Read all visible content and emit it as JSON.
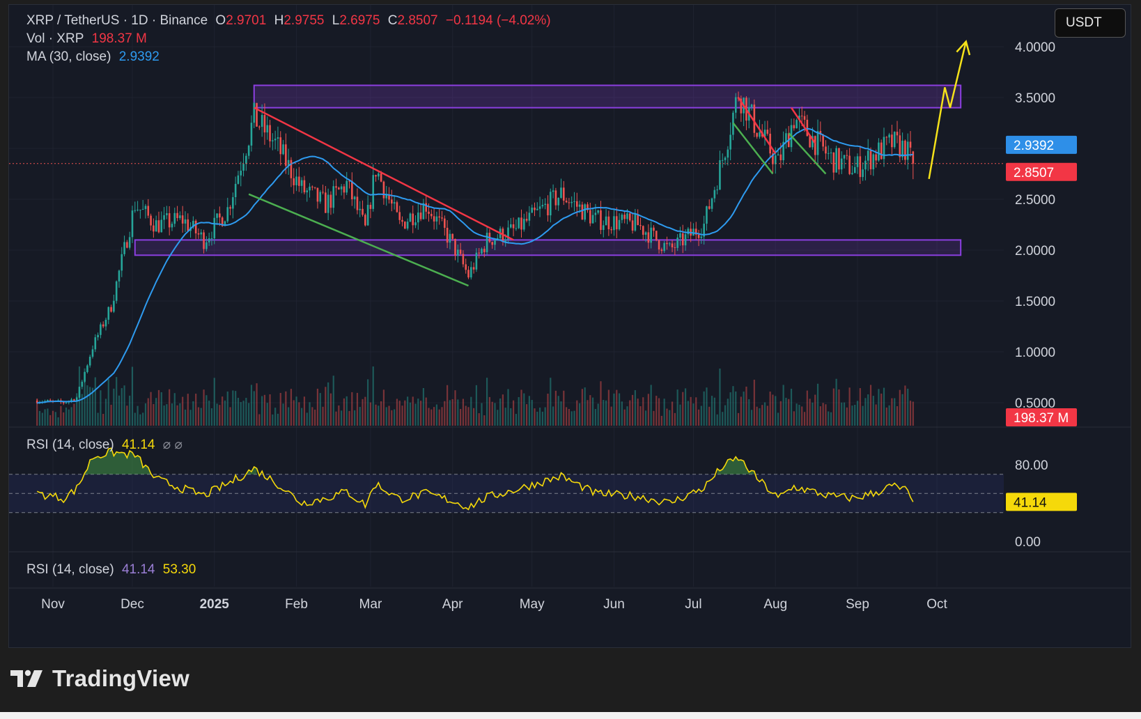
{
  "header": {
    "symbol": "XRP / TetherUS · 1D · Binance",
    "o_label": "O",
    "o_value": "2.9701",
    "h_label": "H",
    "h_value": "2.9755",
    "l_label": "L",
    "l_value": "2.6975",
    "c_label": "C",
    "c_value": "2.8507",
    "change": "−0.1194 (−4.02%)",
    "vol_label": "Vol · XRP",
    "vol_value": "198.37 M",
    "ma_label": "MA (30, close)",
    "ma_value": "2.9392"
  },
  "currency_button": "USDT",
  "rsi_legend": {
    "label": "RSI (14, close)",
    "value": "41.14",
    "icons": "⌀ ⌀"
  },
  "rsi_legend2": {
    "label": "RSI (14, close)",
    "value1": "41.14",
    "value2": "53.30"
  },
  "brand": {
    "name": "TradingView"
  },
  "colors": {
    "background": "#161a25",
    "up": "#26a69a",
    "down": "#ef5350",
    "ma": "#2e9bf0",
    "rsi": "#f5d90a",
    "zone": "#8c3fe0",
    "downtrend": "#f23645",
    "support": "#4caf50",
    "arrow": "#f5e21a"
  },
  "chart_data": [
    {
      "type": "candlestick",
      "title": "XRP / TetherUS · 1D · Binance",
      "x_ticks": [
        "Nov",
        "Dec",
        "2025",
        "Feb",
        "Mar",
        "Apr",
        "May",
        "Jun",
        "Jul",
        "Aug",
        "Sep",
        "Oct"
      ],
      "y_ticks": [
        "0.5000",
        "1.0000",
        "1.5000",
        "2.0000",
        "2.5000",
        "3.5000",
        "4.0000"
      ],
      "ylim": [
        0,
        4.2
      ],
      "close_series": [
        {
          "date": "2024-10-26",
          "close": 0.52
        },
        {
          "date": "2024-11-05",
          "close": 0.5
        },
        {
          "date": "2024-11-10",
          "close": 0.55
        },
        {
          "date": "2024-11-16",
          "close": 1.05
        },
        {
          "date": "2024-11-23",
          "close": 1.45
        },
        {
          "date": "2024-12-02",
          "close": 2.45
        },
        {
          "date": "2024-12-10",
          "close": 2.25
        },
        {
          "date": "2024-12-20",
          "close": 2.3
        },
        {
          "date": "2024-12-28",
          "close": 2.1
        },
        {
          "date": "2025-01-06",
          "close": 2.4
        },
        {
          "date": "2025-01-16",
          "close": 3.3
        },
        {
          "date": "2025-01-24",
          "close": 3.05
        },
        {
          "date": "2025-02-03",
          "close": 2.6
        },
        {
          "date": "2025-02-12",
          "close": 2.45
        },
        {
          "date": "2025-02-20",
          "close": 2.65
        },
        {
          "date": "2025-02-27",
          "close": 2.2
        },
        {
          "date": "2025-03-03",
          "close": 2.8
        },
        {
          "date": "2025-03-12",
          "close": 2.25
        },
        {
          "date": "2025-03-22",
          "close": 2.45
        },
        {
          "date": "2025-03-31",
          "close": 2.1
        },
        {
          "date": "2025-04-07",
          "close": 1.75
        },
        {
          "date": "2025-04-14",
          "close": 2.1
        },
        {
          "date": "2025-04-25",
          "close": 2.2
        },
        {
          "date": "2025-05-12",
          "close": 2.55
        },
        {
          "date": "2025-05-25",
          "close": 2.3
        },
        {
          "date": "2025-06-10",
          "close": 2.25
        },
        {
          "date": "2025-06-22",
          "close": 2.0
        },
        {
          "date": "2025-07-05",
          "close": 2.25
        },
        {
          "date": "2025-07-12",
          "close": 2.9
        },
        {
          "date": "2025-07-18",
          "close": 3.55
        },
        {
          "date": "2025-07-25",
          "close": 3.2
        },
        {
          "date": "2025-08-02",
          "close": 2.85
        },
        {
          "date": "2025-08-08",
          "close": 3.3
        },
        {
          "date": "2025-08-15",
          "close": 3.1
        },
        {
          "date": "2025-08-22",
          "close": 2.9
        },
        {
          "date": "2025-08-31",
          "close": 2.8
        },
        {
          "date": "2025-09-08",
          "close": 2.95
        },
        {
          "date": "2025-09-14",
          "close": 3.05
        },
        {
          "date": "2025-09-19",
          "close": 3.0
        },
        {
          "date": "2025-09-22",
          "close": 2.85
        }
      ],
      "ohlc_last": {
        "open": 2.9701,
        "high": 2.9755,
        "low": 2.6975,
        "close": 2.8507
      },
      "ma30_last": 2.9392,
      "volume_last": "198.37 M",
      "price_labels": [
        "2.9392",
        "2.8507",
        "198.37 M"
      ],
      "annotations": {
        "resistance_zone": [
          3.4,
          3.62
        ],
        "support_zone": [
          1.95,
          2.1
        ],
        "resistance_zone_start": "2025-01-16",
        "support_zone_start": "2024-12-02",
        "zones_end": "2025-10-10",
        "downtrend_lines": [
          [
            [
              "2025-01-16",
              3.4
            ],
            [
              "2025-04-24",
              2.1
            ]
          ],
          [
            [
              "2025-07-18",
              3.5
            ],
            [
              "2025-08-01",
              2.95
            ]
          ],
          [
            [
              "2025-08-07",
              3.4
            ],
            [
              "2025-08-16",
              3.05
            ]
          ]
        ],
        "channel_lines": [
          [
            [
              "2025-01-14",
              2.55
            ],
            [
              "2025-04-07",
              1.65
            ]
          ],
          [
            [
              "2025-07-16",
              3.25
            ],
            [
              "2025-07-31",
              2.75
            ]
          ],
          [
            [
              "2025-08-06",
              3.15
            ],
            [
              "2025-08-20",
              2.75
            ]
          ]
        ],
        "projection_arrow": [
          [
            "2025-09-28",
            2.7
          ],
          [
            "2025-10-04",
            3.6
          ],
          [
            "2025-10-06",
            3.4
          ],
          [
            "2025-10-12",
            4.05
          ]
        ]
      }
    },
    {
      "type": "line",
      "title": "RSI (14, close)",
      "y_ticks": [
        "80.00",
        "0.00"
      ],
      "ylim": [
        -10,
        115
      ],
      "bands": [
        30,
        50,
        70
      ],
      "value_label": "41.14",
      "series": [
        {
          "date": "2024-10-26",
          "rsi": 50
        },
        {
          "date": "2024-11-05",
          "rsi": 45
        },
        {
          "date": "2024-11-10",
          "rsi": 55
        },
        {
          "date": "2024-11-16",
          "rsi": 88
        },
        {
          "date": "2024-11-23",
          "rsi": 93
        },
        {
          "date": "2024-12-02",
          "rsi": 90
        },
        {
          "date": "2024-12-10",
          "rsi": 65
        },
        {
          "date": "2024-12-20",
          "rsi": 55
        },
        {
          "date": "2024-12-28",
          "rsi": 48
        },
        {
          "date": "2025-01-06",
          "rsi": 60
        },
        {
          "date": "2025-01-16",
          "rsi": 76
        },
        {
          "date": "2025-01-24",
          "rsi": 62
        },
        {
          "date": "2025-02-03",
          "rsi": 40
        },
        {
          "date": "2025-02-12",
          "rsi": 45
        },
        {
          "date": "2025-02-20",
          "rsi": 52
        },
        {
          "date": "2025-02-27",
          "rsi": 38
        },
        {
          "date": "2025-03-03",
          "rsi": 60
        },
        {
          "date": "2025-03-12",
          "rsi": 44
        },
        {
          "date": "2025-03-22",
          "rsi": 50
        },
        {
          "date": "2025-03-31",
          "rsi": 43
        },
        {
          "date": "2025-04-07",
          "rsi": 36
        },
        {
          "date": "2025-04-14",
          "rsi": 46
        },
        {
          "date": "2025-04-25",
          "rsi": 54
        },
        {
          "date": "2025-05-12",
          "rsi": 68
        },
        {
          "date": "2025-05-25",
          "rsi": 50
        },
        {
          "date": "2025-06-10",
          "rsi": 47
        },
        {
          "date": "2025-06-22",
          "rsi": 40
        },
        {
          "date": "2025-07-05",
          "rsi": 56
        },
        {
          "date": "2025-07-12",
          "rsi": 78
        },
        {
          "date": "2025-07-18",
          "rsi": 87
        },
        {
          "date": "2025-07-25",
          "rsi": 66
        },
        {
          "date": "2025-08-02",
          "rsi": 45
        },
        {
          "date": "2025-08-08",
          "rsi": 57
        },
        {
          "date": "2025-08-15",
          "rsi": 52
        },
        {
          "date": "2025-08-22",
          "rsi": 47
        },
        {
          "date": "2025-08-31",
          "rsi": 45
        },
        {
          "date": "2025-09-08",
          "rsi": 51
        },
        {
          "date": "2025-09-14",
          "rsi": 58
        },
        {
          "date": "2025-09-19",
          "rsi": 54
        },
        {
          "date": "2025-09-22",
          "rsi": 41.14
        }
      ]
    }
  ]
}
